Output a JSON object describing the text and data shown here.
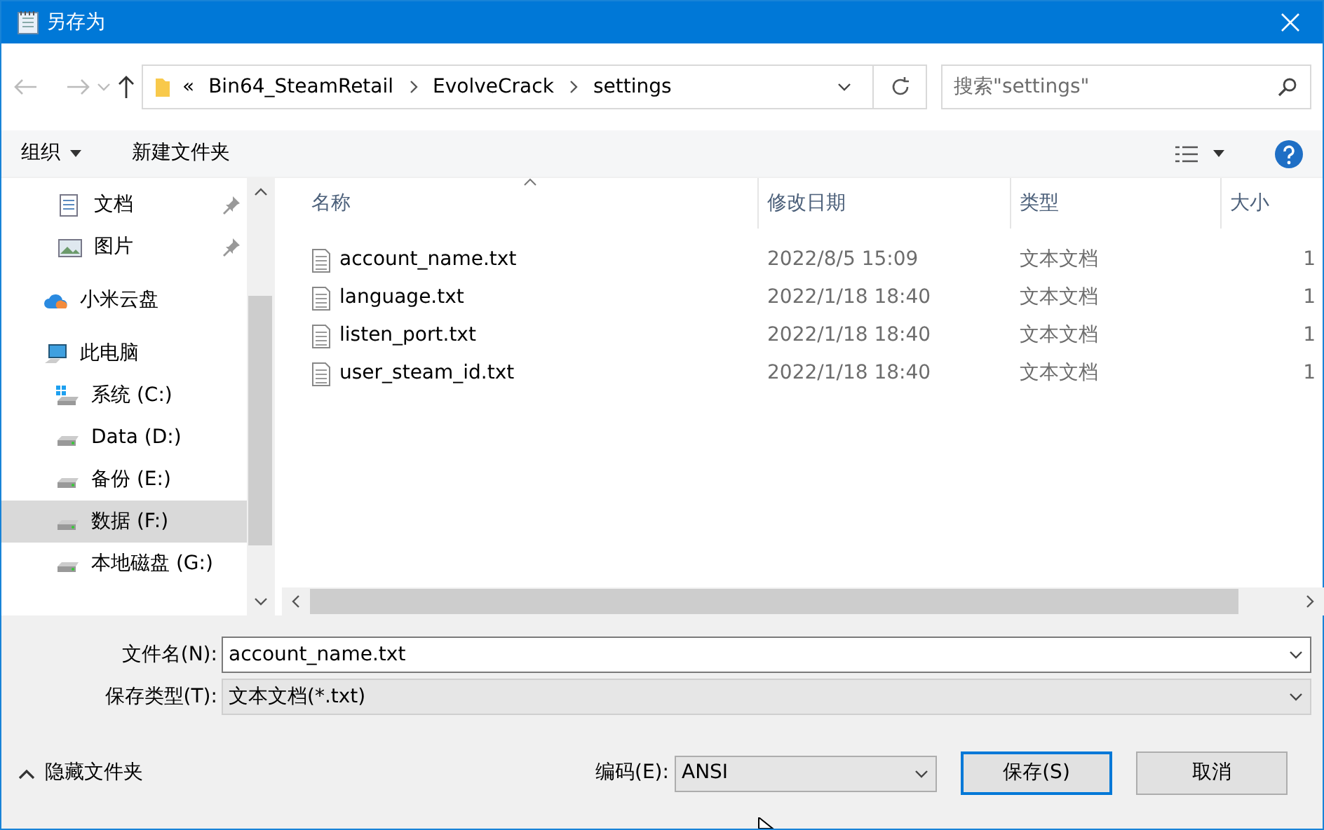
{
  "window": {
    "title": "另存为"
  },
  "address": {
    "overflow": "«",
    "crumbs": [
      "Bin64_SteamRetail",
      "EvolveCrack",
      "settings"
    ]
  },
  "search": {
    "placeholder": "搜索\"settings\""
  },
  "toolbar": {
    "organize": "组织",
    "new_folder": "新建文件夹"
  },
  "sidebar": {
    "items": [
      {
        "label": "文档",
        "kind": "docs",
        "pinned": true,
        "selected": false
      },
      {
        "label": "图片",
        "kind": "pictures",
        "pinned": true,
        "selected": false
      },
      {
        "label": "小米云盘",
        "kind": "cloud",
        "pinned": false,
        "selected": false
      },
      {
        "label": "此电脑",
        "kind": "pc",
        "pinned": false,
        "selected": false,
        "children": [
          {
            "label": "系统 (C:)",
            "kind": "system-drive",
            "pinned": false,
            "selected": false
          },
          {
            "label": "Data (D:)",
            "kind": "drive",
            "pinned": false,
            "selected": false
          },
          {
            "label": "备份 (E:)",
            "kind": "drive",
            "pinned": false,
            "selected": false
          },
          {
            "label": "数据 (F:)",
            "kind": "drive",
            "pinned": false,
            "selected": true
          },
          {
            "label": "本地磁盘 (G:)",
            "kind": "drive",
            "pinned": false,
            "selected": false
          }
        ]
      }
    ]
  },
  "table": {
    "columns": [
      "名称",
      "修改日期",
      "类型",
      "大小"
    ],
    "rows": [
      {
        "name": "account_name.txt",
        "modified": "2022/8/5 15:09",
        "type": "文本文档",
        "size": "1"
      },
      {
        "name": "language.txt",
        "modified": "2022/1/18 18:40",
        "type": "文本文档",
        "size": "1"
      },
      {
        "name": "listen_port.txt",
        "modified": "2022/1/18 18:40",
        "type": "文本文档",
        "size": "1"
      },
      {
        "name": "user_steam_id.txt",
        "modified": "2022/1/18 18:40",
        "type": "文本文档",
        "size": "1"
      }
    ]
  },
  "form": {
    "filename_label": "文件名(N):",
    "filename": "account_name.txt",
    "filetype_label": "保存类型(T):",
    "filetype": "文本文档(*.txt)",
    "encoding_label": "编码(E):",
    "encoding": "ANSI"
  },
  "hide_folders": "隐藏文件夹",
  "buttons": [
    {
      "label": "保存(S)",
      "kind": "default"
    },
    {
      "label": "取消",
      "kind": "normal"
    }
  ]
}
